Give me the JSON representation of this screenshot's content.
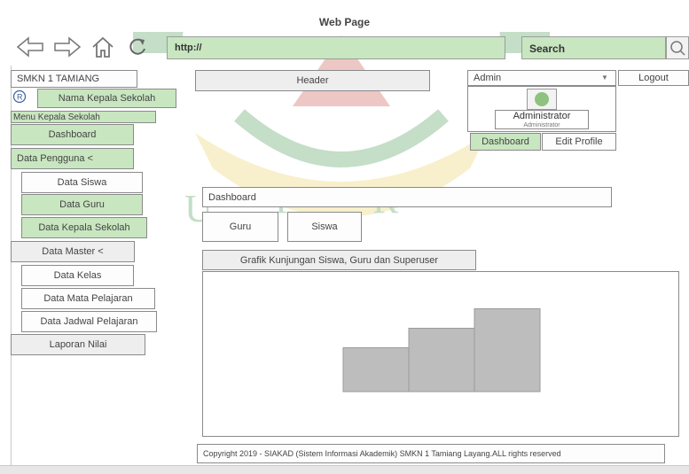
{
  "window": {
    "title": "Web Page"
  },
  "browser": {
    "address_value": "http://",
    "search_value": "Search",
    "icons": [
      "back-arrow-icon",
      "forward-arrow-icon",
      "home-icon",
      "reload-icon",
      "magnifier-icon"
    ]
  },
  "header": {
    "brand": "SMKN 1 TAMIANG",
    "header_label": "Header",
    "user_select": "Admin",
    "logout": "Logout",
    "profile_name": "Administrator",
    "profile_role": "Administrator",
    "profile_tabs": [
      "Dashboard",
      "Edit Profile"
    ]
  },
  "sidebar": {
    "user_name": "Nama Kepala Sekolah",
    "menu_title": "Menu Kepala Sekolah",
    "items": [
      {
        "label": "Dashboard"
      },
      {
        "label": "Data Pengguna <"
      },
      {
        "label": "Data Siswa"
      },
      {
        "label": "Data Guru"
      },
      {
        "label": "Data Kepala Sekolah"
      },
      {
        "label": "Data Master <"
      },
      {
        "label": "Data Kelas"
      },
      {
        "label": "Data Mata Pelajaran"
      },
      {
        "label": "Data Jadwal Pelajaran"
      },
      {
        "label": "Laporan Nilai"
      }
    ]
  },
  "main": {
    "breadcrumb": "Dashboard",
    "tabs": [
      "Guru",
      "Siswa"
    ],
    "chart_title": "Grafik Kunjungan Siswa, Guru dan Superuser"
  },
  "chart_data": {
    "type": "bar",
    "categories": [
      "",
      "",
      ""
    ],
    "values": [
      45,
      65,
      85
    ],
    "ylim": [
      0,
      100
    ],
    "grid": false,
    "color": "#bdbdbd"
  },
  "footer": {
    "copyright": "Copyright 2019 - SIAKAD (Sistem Informasi Akademik) SMKN 1 Tamiang Layang.ALL rights reserved"
  },
  "colors": {
    "accent_green": "#c8e6c0",
    "watermark_green": "#2e8b3a",
    "watermark_gold": "#e8c84a"
  }
}
